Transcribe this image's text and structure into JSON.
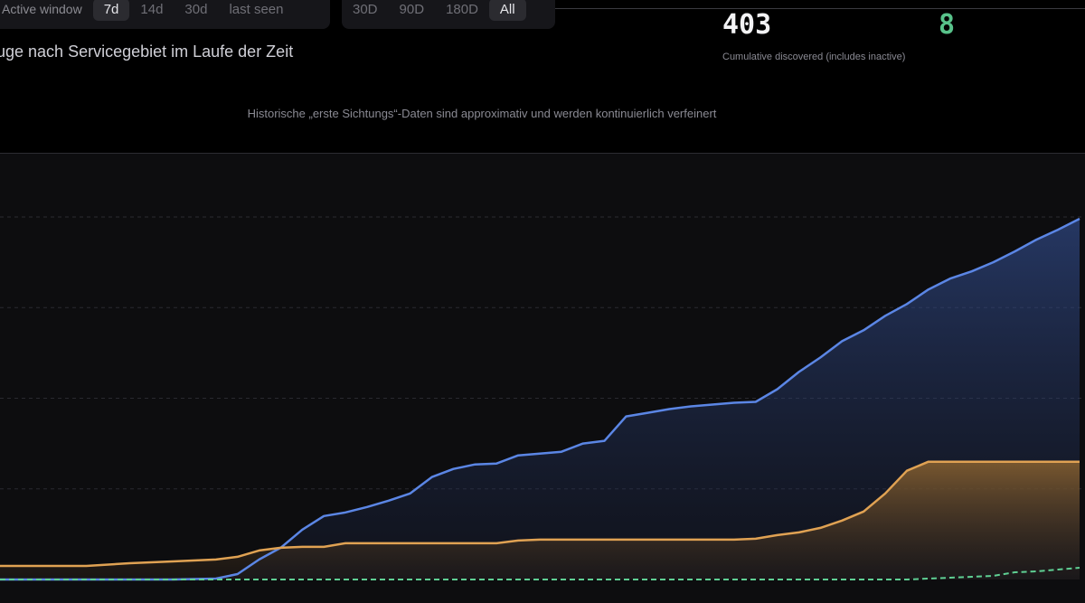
{
  "controls": {
    "window_label": "Active window",
    "window_options": [
      "7d",
      "14d",
      "30d",
      "last seen"
    ],
    "window_selected": "7d",
    "range_options": [
      "30D",
      "90D",
      "180D",
      "All"
    ],
    "range_selected": "All"
  },
  "title": "uge nach Servicegebiet im Laufe der Zeit",
  "notice": "Historische „erste Sichtungs“-Daten sind approximativ und werden kontinuierlich verfeinert",
  "kpis": {
    "total_value": "403",
    "total_caption": "Cumulative discovered (includes inactive)",
    "active_value": "8"
  },
  "colors": {
    "series_blue": "#5b86e5",
    "series_orange": "#e0a253",
    "series_green": "#5fcf93"
  },
  "chart_data": {
    "type": "area",
    "title": "",
    "xlabel": "",
    "ylabel": "",
    "ylim": [
      0,
      410
    ],
    "grid": true,
    "legend": "none",
    "x": [
      0,
      4,
      8,
      12,
      16,
      20,
      22,
      24,
      26,
      28,
      30,
      32,
      34,
      36,
      38,
      40,
      42,
      44,
      46,
      48,
      50,
      52,
      54,
      56,
      58,
      60,
      62,
      64,
      66,
      68,
      70,
      72,
      74,
      76,
      78,
      80,
      82,
      84,
      86,
      88,
      90,
      92,
      94,
      96,
      98,
      100
    ],
    "series": [
      {
        "values": [
          0,
          0,
          0,
          0,
          0,
          1,
          6,
          22,
          35,
          55,
          70,
          74,
          80,
          87,
          95,
          113,
          122,
          127,
          128,
          137,
          139,
          141,
          150,
          153,
          180,
          184,
          188,
          191,
          193,
          195,
          196,
          210,
          229,
          245,
          263,
          275,
          291,
          304,
          320,
          332,
          340,
          350,
          362,
          375,
          386,
          398
        ]
      },
      {
        "values": [
          15,
          15,
          15,
          18,
          20,
          22,
          25,
          32,
          35,
          36,
          36,
          40,
          40,
          40,
          40,
          40,
          40,
          40,
          40,
          43,
          44,
          44,
          44,
          44,
          44,
          44,
          44,
          44,
          44,
          44,
          45,
          49,
          52,
          57,
          65,
          75,
          95,
          120,
          130,
          130,
          130,
          130,
          130,
          130,
          130,
          130
        ]
      },
      {
        "values": [
          0,
          0,
          0,
          0,
          0,
          0,
          0,
          0,
          0,
          0,
          0,
          0,
          0,
          0,
          0,
          0,
          0,
          0,
          0,
          0,
          0,
          0,
          0,
          0,
          0,
          0,
          0,
          0,
          0,
          0,
          0,
          0,
          0,
          0,
          0,
          0,
          0,
          0,
          1,
          2,
          3,
          4,
          8,
          9,
          11,
          13
        ]
      }
    ]
  }
}
